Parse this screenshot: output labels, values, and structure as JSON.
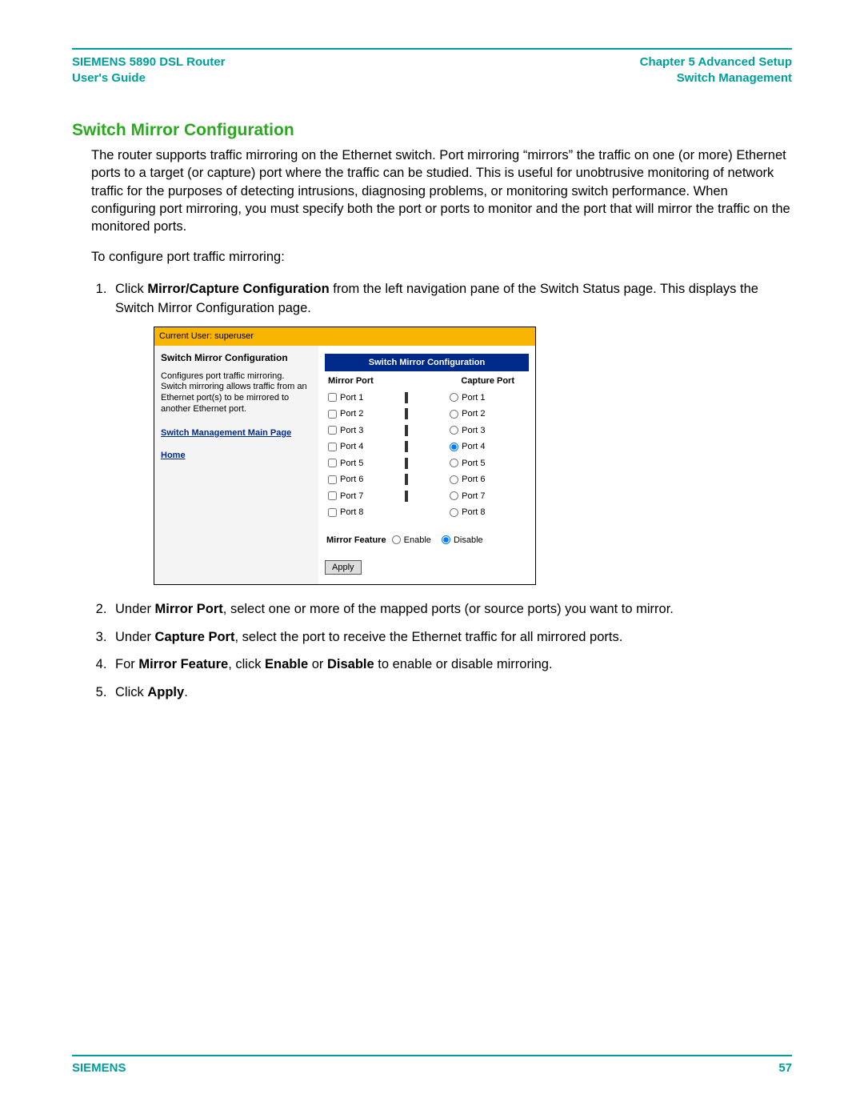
{
  "header": {
    "left_line1": "SIEMENS 5890 DSL Router",
    "left_line2": "User's Guide",
    "right_line1": "Chapter 5   Advanced Setup",
    "right_line2": "Switch Management"
  },
  "section_title": "Switch Mirror Configuration",
  "intro_para": "The router supports traffic mirroring on the Ethernet switch. Port mirroring “mirrors” the traffic on one (or more) Ethernet ports to a target (or capture) port where the traffic can be studied. This is useful for unobtrusive monitoring of network traffic for the purposes of detecting intrusions, diagnosing problems, or monitoring switch performance. When configuring port mirroring, you must specify both the port or ports to monitor and the port that will mirror the traffic on the monitored ports.",
  "config_lead": "To configure port traffic mirroring:",
  "step1": {
    "pre": "Click ",
    "bold": "Mirror/Capture Configuration",
    "post": " from the left navigation pane of the Switch Status page. This displays the Switch Mirror Configuration page."
  },
  "step2": {
    "pre": "Under ",
    "bold": "Mirror Port",
    "post": ", select one or more of the mapped ports (or source ports) you want to mirror."
  },
  "step3": {
    "pre": "Under ",
    "bold": "Capture Port",
    "post": ", select the port to receive the Ethernet traffic for all mirrored ports."
  },
  "step4": {
    "t1": "For ",
    "b1": "Mirror Feature",
    "t2": ", click ",
    "b2": "Enable",
    "t3": " or ",
    "b3": "Disable",
    "t4": " to enable or disable mirroring."
  },
  "step5": {
    "pre": "Click ",
    "bold": "Apply",
    "post": "."
  },
  "shot": {
    "userbar": "Current User: superuser",
    "side_title": "Switch Mirror Configuration",
    "side_desc": "Configures port traffic mirroring. Switch mirroring allows traffic from an Ethernet port(s) to be mirrored to another Ethernet port.",
    "link1": "Switch Management Main Page",
    "link2": "Home",
    "table_title": "Switch Mirror Configuration",
    "col_mirror": "Mirror Port",
    "col_capture": "Capture Port",
    "ports": [
      "Port 1",
      "Port 2",
      "Port 3",
      "Port 4",
      "Port 5",
      "Port 6",
      "Port 7",
      "Port 8"
    ],
    "capture_selected_index": 3,
    "mirror_feature_label": "Mirror Feature",
    "enable_label": "Enable",
    "disable_label": "Disable",
    "mirror_feature_value": "disable",
    "apply_label": "Apply"
  },
  "footer": {
    "brand": "SIEMENS",
    "page": "57"
  }
}
